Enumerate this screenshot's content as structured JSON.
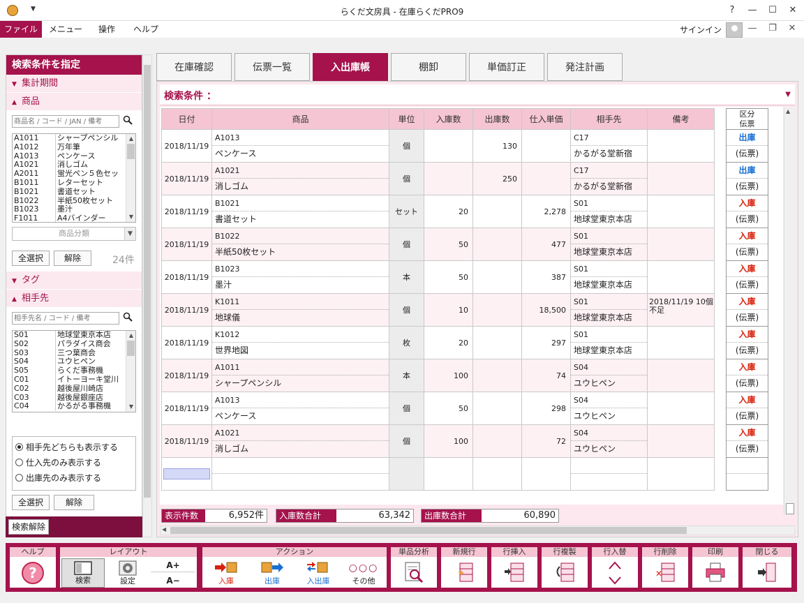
{
  "window": {
    "title": "らくだ文房具 - 在庫らくだPRO9",
    "help": "?",
    "minimize": "—",
    "maximize": "☐",
    "close": "✕"
  },
  "menu": {
    "file": "ファイル",
    "items": [
      "メニュー",
      "操作",
      "ヘルプ"
    ],
    "signin": "サインイン"
  },
  "left": {
    "title": "検索条件を指定",
    "sections": {
      "period": "集計期間",
      "product": "商品",
      "tag": "タグ",
      "partner": "相手先"
    },
    "product_search_placeholder": "商品名 / コード / JAN / 備考",
    "products": [
      {
        "code": "A1011",
        "name": "シャープペンシル"
      },
      {
        "code": "A1012",
        "name": "万年筆"
      },
      {
        "code": "A1013",
        "name": "ペンケース"
      },
      {
        "code": "A1021",
        "name": "消しゴム"
      },
      {
        "code": "A2011",
        "name": "蛍光ペン５色セッ"
      },
      {
        "code": "B1011",
        "name": "レターセット"
      },
      {
        "code": "B1021",
        "name": "書道セット"
      },
      {
        "code": "B1022",
        "name": "半紙50枚セット"
      },
      {
        "code": "B1023",
        "name": "墨汁"
      },
      {
        "code": "F1011",
        "name": "A4バインダー"
      }
    ],
    "category_placeholder": "商品分類",
    "select_all": "全選択",
    "clear": "解除",
    "product_count": "24件",
    "partner_search_placeholder": "相手先名 / コード / 備考",
    "partners": [
      {
        "code": "S01",
        "name": "地球堂東京本店"
      },
      {
        "code": "S02",
        "name": "パラダイス商会"
      },
      {
        "code": "S03",
        "name": "三つ葉商会"
      },
      {
        "code": "S04",
        "name": "ユウヒペン"
      },
      {
        "code": "S05",
        "name": "らくだ事務機"
      },
      {
        "code": "C01",
        "name": "イトーヨーキ堂川"
      },
      {
        "code": "C02",
        "name": "越後屋川崎店"
      },
      {
        "code": "C03",
        "name": "越後屋銀座店"
      },
      {
        "code": "C04",
        "name": "かるがる事務機"
      }
    ],
    "radios": [
      "相手先どちらも表示する",
      "仕入先のみ表示する",
      "出庫先のみ表示する"
    ],
    "search_clear": "検索解除"
  },
  "tabs": [
    "在庫確認",
    "伝票一覧",
    "入出庫帳",
    "棚卸",
    "単価訂正",
    "発注計画"
  ],
  "criteria_label": "検索条件 ：",
  "grid": {
    "headers": [
      "日付",
      "商品",
      "単位",
      "入庫数",
      "出庫数",
      "仕入単価",
      "相手先",
      "備考"
    ],
    "kubun_header": [
      "区分",
      "伝票"
    ],
    "rows": [
      {
        "date": "2018/11/19",
        "code": "A1013",
        "name": "ペンケース",
        "unit": "個",
        "in": "",
        "out": "130",
        "price": "",
        "pcode": "C17",
        "pname": "かるがる堂新宿",
        "note": "",
        "kubun": "出庫",
        "slip": "(伝票)"
      },
      {
        "date": "2018/11/19",
        "code": "A1021",
        "name": "消しゴム",
        "unit": "個",
        "in": "",
        "out": "250",
        "price": "",
        "pcode": "C17",
        "pname": "かるがる堂新宿",
        "note": "",
        "kubun": "出庫",
        "slip": "(伝票)"
      },
      {
        "date": "2018/11/19",
        "code": "B1021",
        "name": "書道セット",
        "unit": "セット",
        "in": "20",
        "out": "",
        "price": "2,278",
        "pcode": "S01",
        "pname": "地球堂東京本店",
        "note": "",
        "kubun": "入庫",
        "slip": "(伝票)"
      },
      {
        "date": "2018/11/19",
        "code": "B1022",
        "name": "半紙50枚セット",
        "unit": "個",
        "in": "50",
        "out": "",
        "price": "477",
        "pcode": "S01",
        "pname": "地球堂東京本店",
        "note": "",
        "kubun": "入庫",
        "slip": "(伝票)"
      },
      {
        "date": "2018/11/19",
        "code": "B1023",
        "name": "墨汁",
        "unit": "本",
        "in": "50",
        "out": "",
        "price": "387",
        "pcode": "S01",
        "pname": "地球堂東京本店",
        "note": "",
        "kubun": "入庫",
        "slip": "(伝票)"
      },
      {
        "date": "2018/11/19",
        "code": "K1011",
        "name": "地球儀",
        "unit": "個",
        "in": "10",
        "out": "",
        "price": "18,500",
        "pcode": "S01",
        "pname": "地球堂東京本店",
        "note": "2018/11/19 10個不足",
        "kubun": "入庫",
        "slip": "(伝票)"
      },
      {
        "date": "2018/11/19",
        "code": "K1012",
        "name": "世界地図",
        "unit": "枚",
        "in": "20",
        "out": "",
        "price": "297",
        "pcode": "S01",
        "pname": "地球堂東京本店",
        "note": "",
        "kubun": "入庫",
        "slip": "(伝票)"
      },
      {
        "date": "2018/11/19",
        "code": "A1011",
        "name": "シャープペンシル",
        "unit": "本",
        "in": "100",
        "out": "",
        "price": "74",
        "pcode": "S04",
        "pname": "ユウヒペン",
        "note": "",
        "kubun": "入庫",
        "slip": "(伝票)"
      },
      {
        "date": "2018/11/19",
        "code": "A1013",
        "name": "ペンケース",
        "unit": "個",
        "in": "50",
        "out": "",
        "price": "298",
        "pcode": "S04",
        "pname": "ユウヒペン",
        "note": "",
        "kubun": "入庫",
        "slip": "(伝票)"
      },
      {
        "date": "2018/11/19",
        "code": "A1021",
        "name": "消しゴム",
        "unit": "個",
        "in": "100",
        "out": "",
        "price": "72",
        "pcode": "S04",
        "pname": "ユウヒペン",
        "note": "",
        "kubun": "入庫",
        "slip": "(伝票)"
      }
    ]
  },
  "summary": {
    "count_label": "表示件数",
    "count": "6,952件",
    "in_label": "入庫数合計",
    "in_total": "63,342",
    "out_label": "出庫数合計",
    "out_total": "60,890"
  },
  "toolbar": {
    "help_group": "ヘルプ",
    "layout_group": "レイアウト",
    "layout_search": "検索",
    "layout_settings": "設定",
    "font_up": "A+",
    "font_down": "A−",
    "action_group": "アクション",
    "action_in": "入庫",
    "action_out": "出庫",
    "action_inout": "入出庫",
    "action_other": "その他",
    "item_analysis": "単品分析",
    "new_row": "新規行",
    "insert_row": "行挿入",
    "copy_row": "行複製",
    "swap_row": "行入替",
    "delete_row": "行削除",
    "print": "印刷",
    "close": "閉じる"
  }
}
